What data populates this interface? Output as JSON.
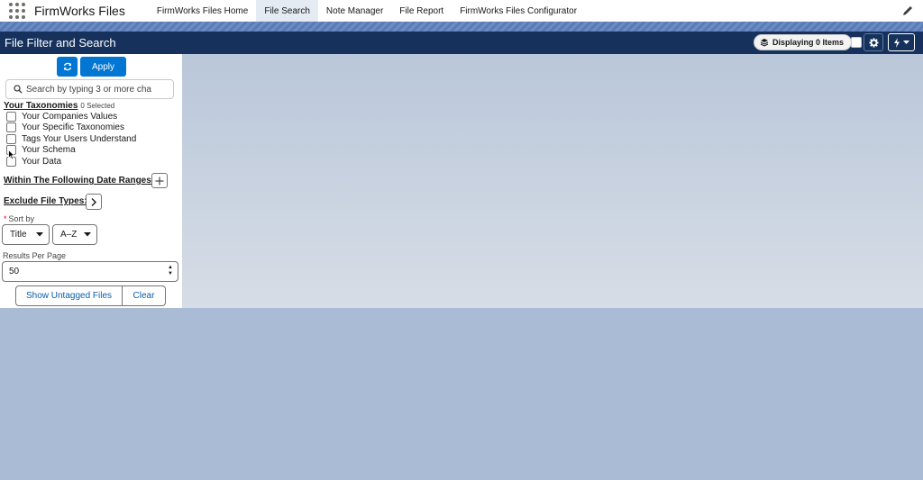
{
  "app": {
    "name": "FirmWorks Files",
    "tabs": [
      {
        "label": "FirmWorks Files Home"
      },
      {
        "label": "File Search"
      },
      {
        "label": "Note Manager"
      },
      {
        "label": "File Report"
      },
      {
        "label": "FirmWorks Files Configurator"
      }
    ],
    "active_tab": "File Search"
  },
  "header": {
    "title": "File Filter and Search",
    "display_label": "Displaying 0 Items"
  },
  "filters": {
    "apply_label": "Apply",
    "search_placeholder": "Search by typing 3 or more cha",
    "taxonomies_heading": "Your Taxonomies",
    "taxonomies_selected": "0 Selected",
    "taxonomies": [
      {
        "label": "Your Companies Values"
      },
      {
        "label": "Your Specific Taxonomies"
      },
      {
        "label": "Tags Your Users Understand"
      },
      {
        "label": "Your Schema"
      },
      {
        "label": "Your Data"
      }
    ],
    "date_ranges_heading": "Within The Following Date Ranges:",
    "exclude_heading": "Exclude File Types:",
    "sort_label": "Sort by",
    "sort_field": "Title",
    "sort_order": "A–Z",
    "results_label": "Results Per Page",
    "results_value": "50",
    "show_untagged_label": "Show Untagged Files",
    "clear_label": "Clear"
  },
  "colors": {
    "brand_blue": "#0176d3",
    "header_navy": "#16325c",
    "background": "#aabbd5"
  }
}
